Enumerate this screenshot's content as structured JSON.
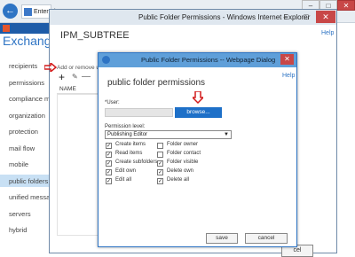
{
  "back_window": {
    "tab_label": "Enterprise",
    "brand": "Exchange",
    "nav_items": [
      "recipients",
      "permissions",
      "compliance mana",
      "organization",
      "protection",
      "mail flow",
      "mobile",
      "public folders",
      "unified message",
      "servers",
      "hybrid"
    ],
    "selected_nav": "public folders"
  },
  "ie_window": {
    "title": "Public Folder Permissions - Windows Internet Explorer",
    "heading": "IPM_SUBTREE",
    "help": "Help",
    "add_remove": "Add or remove use",
    "add_glyph": "+",
    "edit_glyph": "✎",
    "remove_glyph": "—",
    "name_column": "NAME",
    "cancel_partial": "cel"
  },
  "dialog": {
    "title": "Public Folder Permissions -- Webpage Dialog",
    "help": "Help",
    "heading": "public folder permissions",
    "user_label": "*User:",
    "user_value": "",
    "browse_label": "browse...",
    "permission_label": "Permission level:",
    "permission_value": "Publishing Editor",
    "left_checks": [
      {
        "label": "Create items",
        "checked": true
      },
      {
        "label": "Read items",
        "checked": true
      },
      {
        "label": "Create subfolders",
        "checked": true
      },
      {
        "label": "Edit own",
        "checked": true
      },
      {
        "label": "Edit all",
        "checked": true
      }
    ],
    "right_checks": [
      {
        "label": "Folder owner",
        "checked": false
      },
      {
        "label": "Folder contact",
        "checked": false
      },
      {
        "label": "Folder visible",
        "checked": true
      },
      {
        "label": "Delete own",
        "checked": true
      },
      {
        "label": "Delete all",
        "checked": true
      }
    ],
    "save_label": "save",
    "cancel_label": "cancel"
  },
  "colors": {
    "accent": "#2e74c4",
    "selected_nav_bg": "#c8e0f4",
    "browse_bg": "#1e70c8",
    "annotation": "#d21c1c"
  }
}
